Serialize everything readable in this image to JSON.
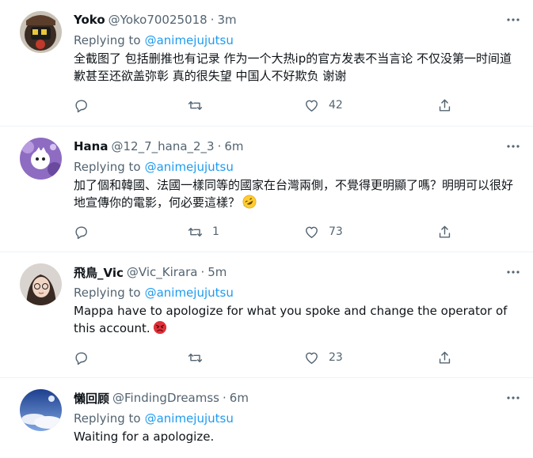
{
  "replying_label": "Replying to",
  "tweets": [
    {
      "display_name": "Yoko",
      "handle": "@Yoko70025018",
      "time": "3m",
      "mention": "@animejujutsu",
      "content": "全截图了 包括删推也有记录 作为一个大热ip的官方发表不当言论 不仅没第一时间道歉甚至还欲盖弥彰 真的很失望 中国人不好欺负 谢谢",
      "retweets": "",
      "likes": "42"
    },
    {
      "display_name": "Hana",
      "handle": "@12_7_hana_2_3",
      "time": "6m",
      "mention": "@animejujutsu",
      "content": "加了個和韓國、法國一樣同等的國家在台灣兩側，不覺得更明顯了嗎？明明可以很好地宣傳你的電影，何必要這樣？",
      "emoji": "rolling-on-floor-laughing-emoji",
      "retweets": "1",
      "likes": "73"
    },
    {
      "display_name": "飛鳥_Vic",
      "handle": "@Vic_Kirara",
      "time": "5m",
      "mention": "@animejujutsu",
      "content": "Mappa have to apologize for what you spoke and change the operator of this account.",
      "emoji": "angry-face-emoji",
      "retweets": "",
      "likes": "23"
    },
    {
      "display_name": "懶回顾",
      "handle": "@FindingDreamss",
      "time": "6m",
      "mention": "@animejujutsu",
      "content": "Waiting for a apologize."
    }
  ],
  "colors": {
    "text": "#0f1419",
    "secondary": "#536471",
    "link": "#1d9bf0",
    "border": "#eff3f4"
  },
  "icons": [
    "more-icon",
    "reply-icon",
    "retweet-icon",
    "like-icon",
    "share-icon"
  ]
}
